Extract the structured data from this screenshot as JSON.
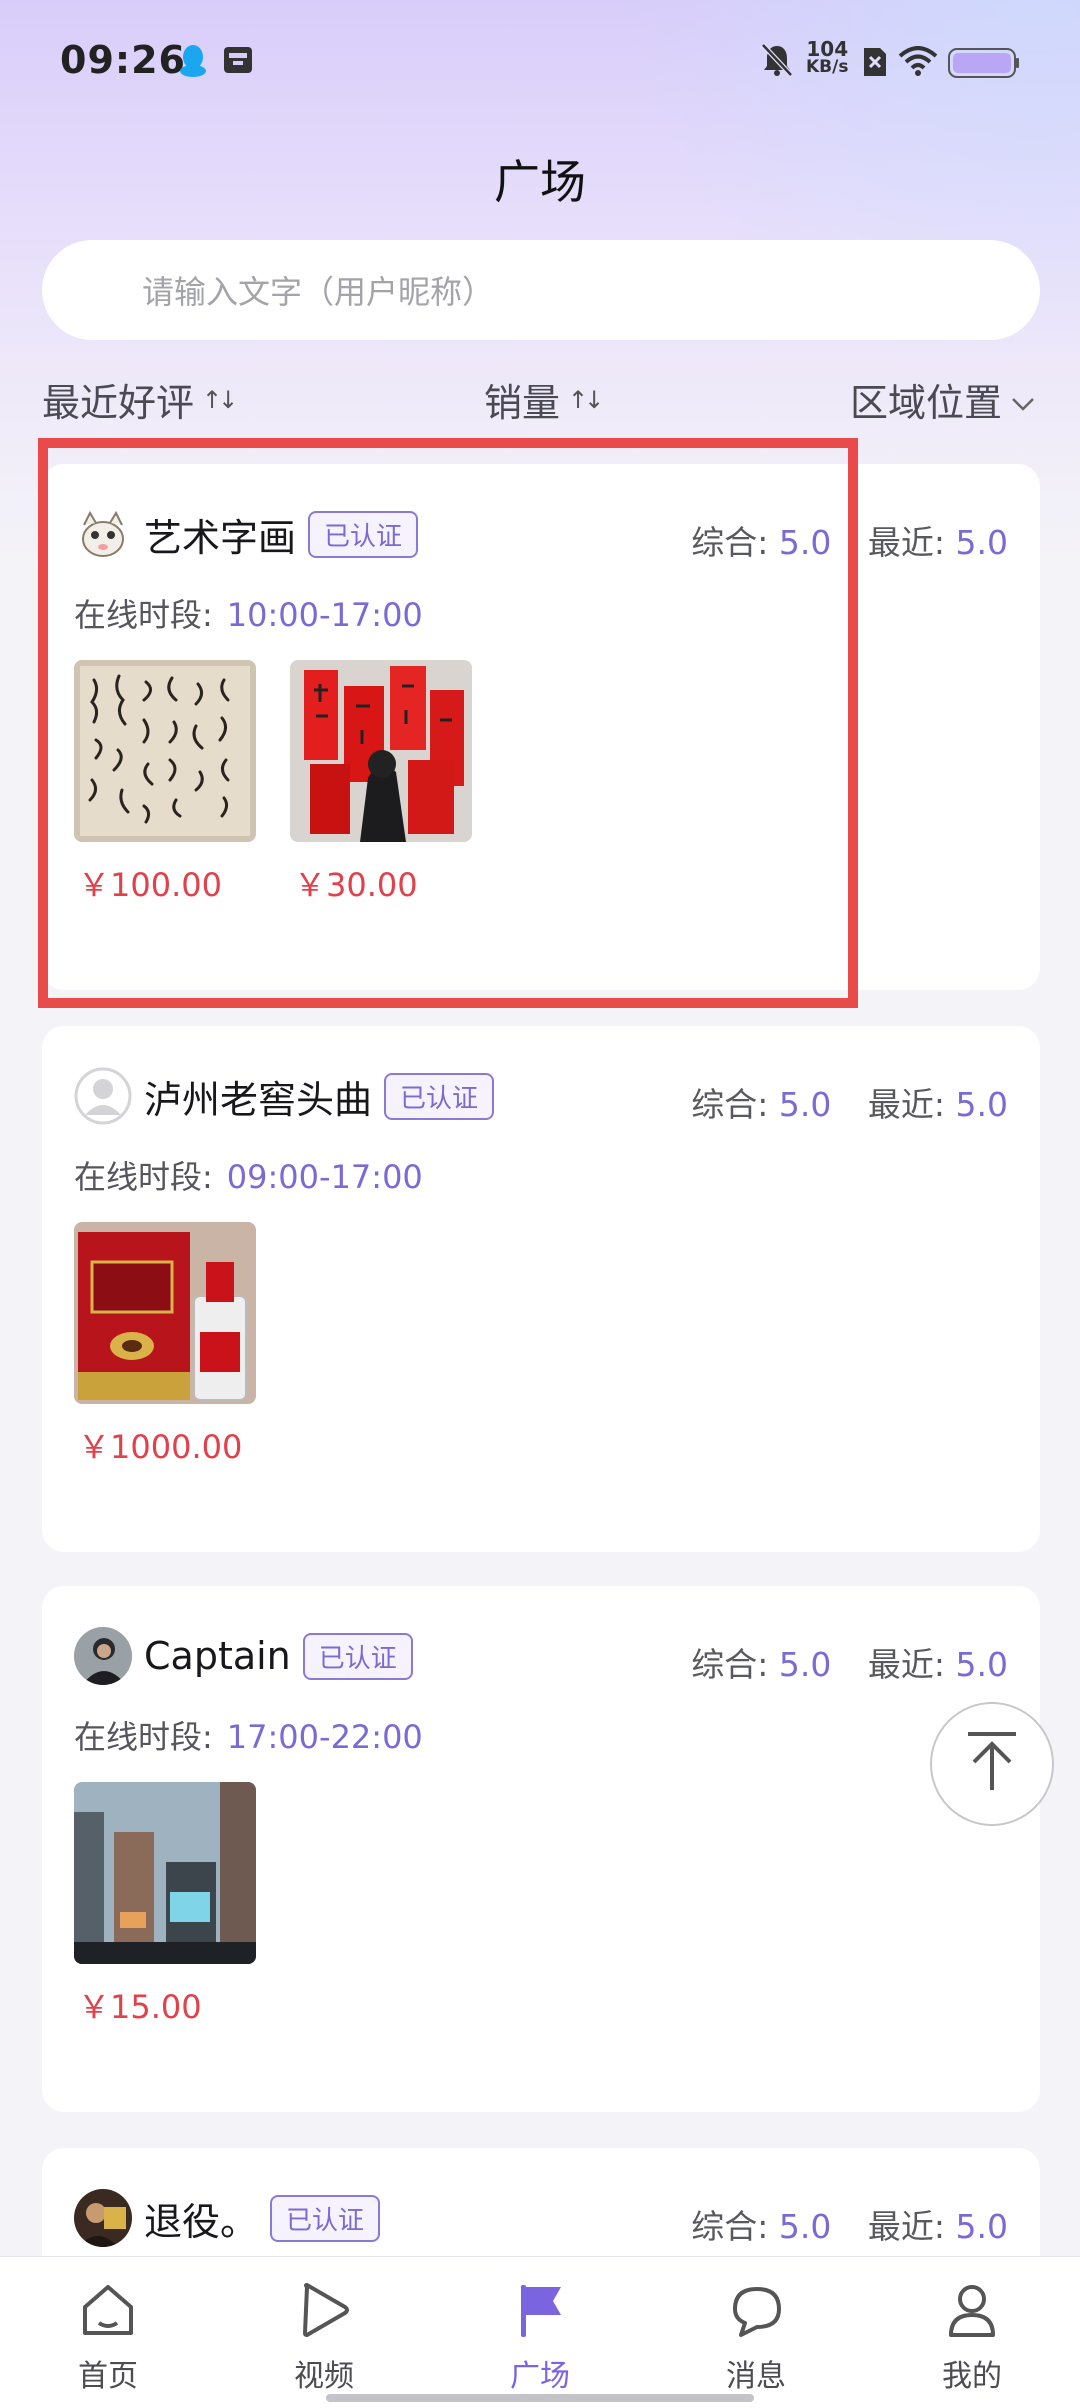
{
  "status_bar": {
    "time": "09:26",
    "net_speed_value": "104",
    "net_speed_unit": "KB/s",
    "icons": [
      "qq-icon",
      "wallet-icon",
      "mute-bell-icon",
      "sim-off-icon",
      "wifi-icon",
      "battery-icon"
    ]
  },
  "header": {
    "title": "广场"
  },
  "search": {
    "placeholder": "请输入文字（用户昵称）"
  },
  "filters": {
    "recent_reviews": "最近好评",
    "sales": "销量",
    "region": "区域位置"
  },
  "labels": {
    "verified": "已认证",
    "overall": "综合:",
    "recent": "最近:",
    "online_period": "在线时段:"
  },
  "cards": [
    {
      "name": "艺术字画",
      "overall": "5.0",
      "recent": "5.0",
      "online_time": "10:00-17:00",
      "prices": [
        "￥100.00",
        "￥30.00"
      ]
    },
    {
      "name": "泸州老窖头曲",
      "overall": "5.0",
      "recent": "5.0",
      "online_time": "09:00-17:00",
      "prices": [
        "￥1000.00"
      ]
    },
    {
      "name": "Captain",
      "overall": "5.0",
      "recent": "5.0",
      "online_time": "17:00-22:00",
      "prices": [
        "￥15.00"
      ]
    },
    {
      "name": "退役。",
      "overall": "5.0",
      "recent": "5.0"
    }
  ],
  "tabbar": {
    "home": "首页",
    "video": "视频",
    "square": "广场",
    "message": "消息",
    "mine": "我的",
    "active": "square"
  },
  "colors": {
    "accent": "#7a64e0",
    "price": "#e0414a",
    "highlight_box": "#e94b4b"
  }
}
